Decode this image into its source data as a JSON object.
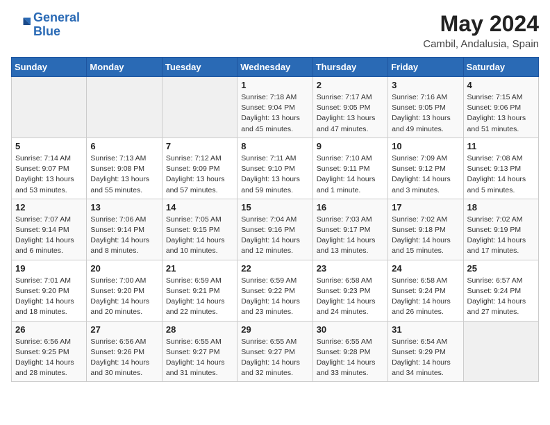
{
  "header": {
    "logo_line1": "General",
    "logo_line2": "Blue",
    "month_year": "May 2024",
    "location": "Cambil, Andalusia, Spain"
  },
  "days_of_week": [
    "Sunday",
    "Monday",
    "Tuesday",
    "Wednesday",
    "Thursday",
    "Friday",
    "Saturday"
  ],
  "weeks": [
    [
      {
        "day": "",
        "info": ""
      },
      {
        "day": "",
        "info": ""
      },
      {
        "day": "",
        "info": ""
      },
      {
        "day": "1",
        "info": "Sunrise: 7:18 AM\nSunset: 9:04 PM\nDaylight: 13 hours\nand 45 minutes."
      },
      {
        "day": "2",
        "info": "Sunrise: 7:17 AM\nSunset: 9:05 PM\nDaylight: 13 hours\nand 47 minutes."
      },
      {
        "day": "3",
        "info": "Sunrise: 7:16 AM\nSunset: 9:05 PM\nDaylight: 13 hours\nand 49 minutes."
      },
      {
        "day": "4",
        "info": "Sunrise: 7:15 AM\nSunset: 9:06 PM\nDaylight: 13 hours\nand 51 minutes."
      }
    ],
    [
      {
        "day": "5",
        "info": "Sunrise: 7:14 AM\nSunset: 9:07 PM\nDaylight: 13 hours\nand 53 minutes."
      },
      {
        "day": "6",
        "info": "Sunrise: 7:13 AM\nSunset: 9:08 PM\nDaylight: 13 hours\nand 55 minutes."
      },
      {
        "day": "7",
        "info": "Sunrise: 7:12 AM\nSunset: 9:09 PM\nDaylight: 13 hours\nand 57 minutes."
      },
      {
        "day": "8",
        "info": "Sunrise: 7:11 AM\nSunset: 9:10 PM\nDaylight: 13 hours\nand 59 minutes."
      },
      {
        "day": "9",
        "info": "Sunrise: 7:10 AM\nSunset: 9:11 PM\nDaylight: 14 hours\nand 1 minute."
      },
      {
        "day": "10",
        "info": "Sunrise: 7:09 AM\nSunset: 9:12 PM\nDaylight: 14 hours\nand 3 minutes."
      },
      {
        "day": "11",
        "info": "Sunrise: 7:08 AM\nSunset: 9:13 PM\nDaylight: 14 hours\nand 5 minutes."
      }
    ],
    [
      {
        "day": "12",
        "info": "Sunrise: 7:07 AM\nSunset: 9:14 PM\nDaylight: 14 hours\nand 6 minutes."
      },
      {
        "day": "13",
        "info": "Sunrise: 7:06 AM\nSunset: 9:14 PM\nDaylight: 14 hours\nand 8 minutes."
      },
      {
        "day": "14",
        "info": "Sunrise: 7:05 AM\nSunset: 9:15 PM\nDaylight: 14 hours\nand 10 minutes."
      },
      {
        "day": "15",
        "info": "Sunrise: 7:04 AM\nSunset: 9:16 PM\nDaylight: 14 hours\nand 12 minutes."
      },
      {
        "day": "16",
        "info": "Sunrise: 7:03 AM\nSunset: 9:17 PM\nDaylight: 14 hours\nand 13 minutes."
      },
      {
        "day": "17",
        "info": "Sunrise: 7:02 AM\nSunset: 9:18 PM\nDaylight: 14 hours\nand 15 minutes."
      },
      {
        "day": "18",
        "info": "Sunrise: 7:02 AM\nSunset: 9:19 PM\nDaylight: 14 hours\nand 17 minutes."
      }
    ],
    [
      {
        "day": "19",
        "info": "Sunrise: 7:01 AM\nSunset: 9:20 PM\nDaylight: 14 hours\nand 18 minutes."
      },
      {
        "day": "20",
        "info": "Sunrise: 7:00 AM\nSunset: 9:20 PM\nDaylight: 14 hours\nand 20 minutes."
      },
      {
        "day": "21",
        "info": "Sunrise: 6:59 AM\nSunset: 9:21 PM\nDaylight: 14 hours\nand 22 minutes."
      },
      {
        "day": "22",
        "info": "Sunrise: 6:59 AM\nSunset: 9:22 PM\nDaylight: 14 hours\nand 23 minutes."
      },
      {
        "day": "23",
        "info": "Sunrise: 6:58 AM\nSunset: 9:23 PM\nDaylight: 14 hours\nand 24 minutes."
      },
      {
        "day": "24",
        "info": "Sunrise: 6:58 AM\nSunset: 9:24 PM\nDaylight: 14 hours\nand 26 minutes."
      },
      {
        "day": "25",
        "info": "Sunrise: 6:57 AM\nSunset: 9:24 PM\nDaylight: 14 hours\nand 27 minutes."
      }
    ],
    [
      {
        "day": "26",
        "info": "Sunrise: 6:56 AM\nSunset: 9:25 PM\nDaylight: 14 hours\nand 28 minutes."
      },
      {
        "day": "27",
        "info": "Sunrise: 6:56 AM\nSunset: 9:26 PM\nDaylight: 14 hours\nand 30 minutes."
      },
      {
        "day": "28",
        "info": "Sunrise: 6:55 AM\nSunset: 9:27 PM\nDaylight: 14 hours\nand 31 minutes."
      },
      {
        "day": "29",
        "info": "Sunrise: 6:55 AM\nSunset: 9:27 PM\nDaylight: 14 hours\nand 32 minutes."
      },
      {
        "day": "30",
        "info": "Sunrise: 6:55 AM\nSunset: 9:28 PM\nDaylight: 14 hours\nand 33 minutes."
      },
      {
        "day": "31",
        "info": "Sunrise: 6:54 AM\nSunset: 9:29 PM\nDaylight: 14 hours\nand 34 minutes."
      },
      {
        "day": "",
        "info": ""
      }
    ]
  ]
}
